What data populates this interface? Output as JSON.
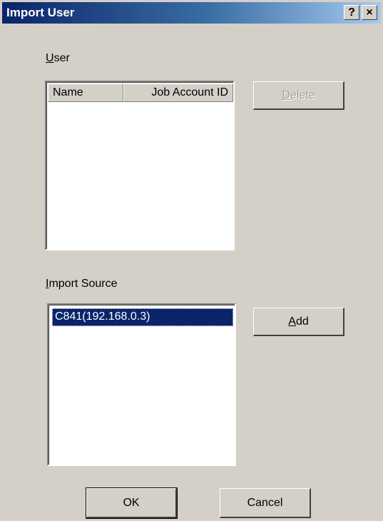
{
  "window": {
    "title": "Import User",
    "help_label": "?",
    "close_label": "×"
  },
  "user_group": {
    "label": "User",
    "mnemonic": "U",
    "label_rest": "ser",
    "columns": [
      "Name",
      "Job Account ID"
    ],
    "rows": []
  },
  "delete_button": {
    "label_mnemonic": "D",
    "label_rest": "elete",
    "enabled": false
  },
  "import_source_group": {
    "mnemonic": "I",
    "label_rest": "mport Source",
    "items": [
      "C841(192.168.0.3)"
    ],
    "selected_index": 0
  },
  "add_button": {
    "label_mnemonic": "A",
    "label_rest": "dd"
  },
  "ok_button": {
    "label": "OK"
  },
  "cancel_button": {
    "label": "Cancel"
  },
  "colors": {
    "title_bar": "#0a246a",
    "dialog_face": "#d4d0c8",
    "selection": "#0a246a"
  }
}
